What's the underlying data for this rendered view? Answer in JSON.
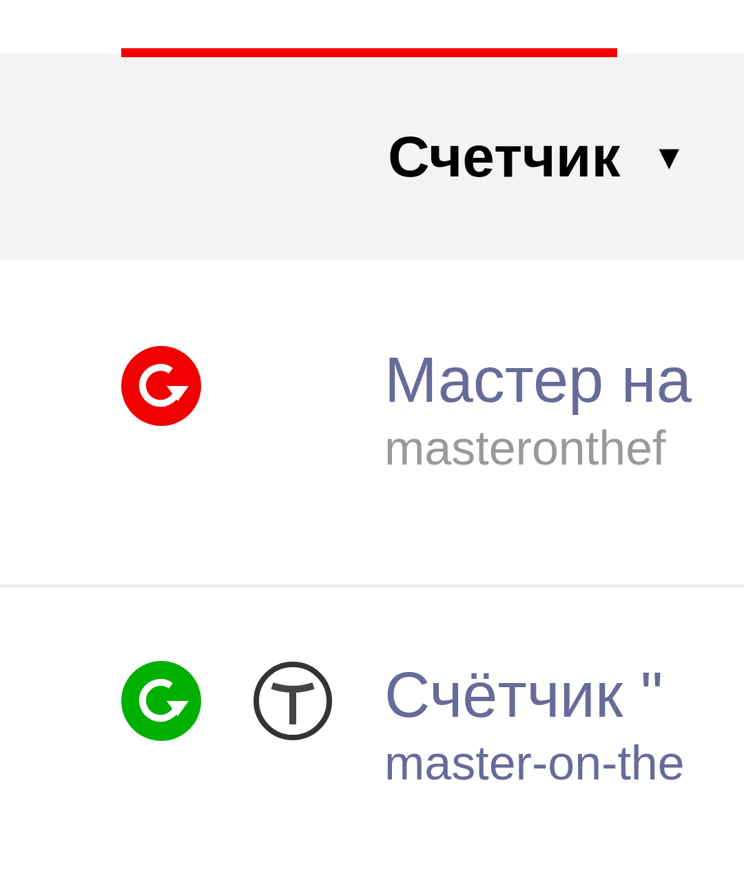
{
  "tab_indicator": {
    "selected": true
  },
  "header": {
    "column": "Счетчик",
    "sort_arrow": "▼"
  },
  "rows": [
    {
      "color": "#f00000",
      "extra_icon": false,
      "title": "Мастер на",
      "subtitle": "masteronthef",
      "subtitle_link": false
    },
    {
      "color": "#00b000",
      "extra_icon": true,
      "title": "Счётчик \"",
      "subtitle": "master-on-the",
      "subtitle_link": true
    }
  ]
}
